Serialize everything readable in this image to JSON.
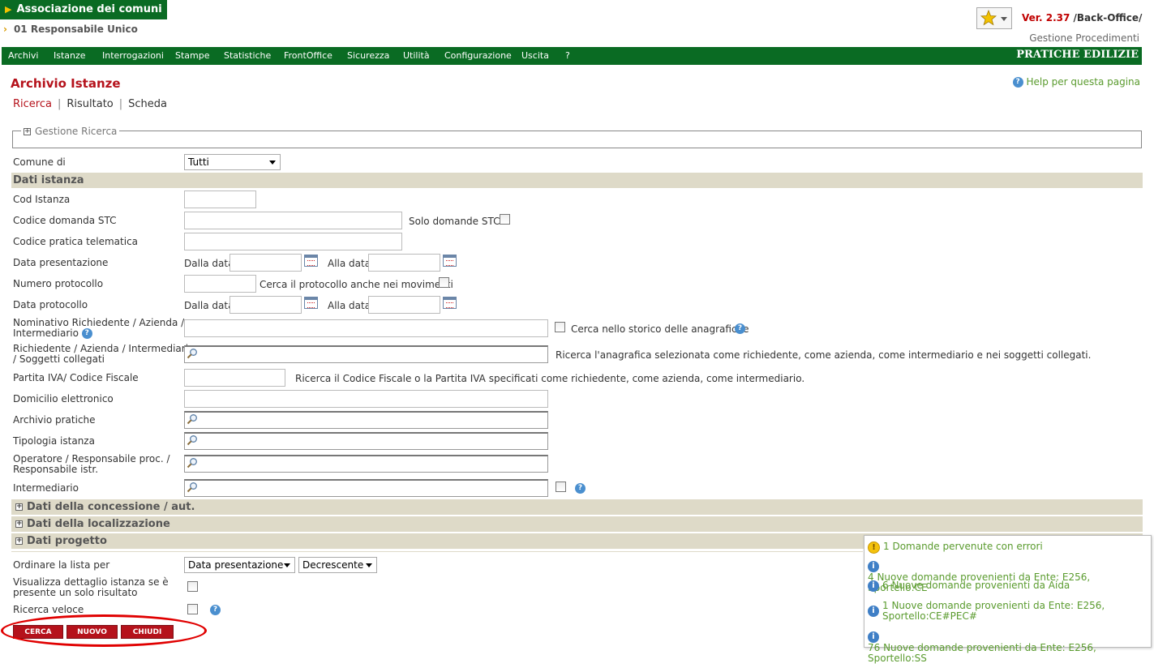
{
  "header": {
    "tree_root": "Associazione dei comuni",
    "tree_child": "01 Responsabile Unico",
    "version_label": "Ver. 2.37",
    "version_suffix": " /Back-Office/",
    "subtitle": "Gestione Procedimenti"
  },
  "menu": {
    "items": [
      "Archivi",
      "Istanze",
      "Interrogazioni",
      "Stampe",
      "Statistiche",
      "FrontOffice",
      "Sicurezza",
      "Utilità",
      "Configurazione",
      "Uscita",
      "?"
    ],
    "brand": "PRATICHE EDILIZIE"
  },
  "page": {
    "title": "Archivio Istanze",
    "help": "Help per questa pagina",
    "tabs": [
      "Ricerca",
      "Risultato",
      "Scheda"
    ],
    "active_tab": "Ricerca",
    "fieldset_legend": "Gestione Ricerca"
  },
  "form": {
    "comune_label": "Comune di",
    "comune_value": "Tutti",
    "section_dati_istanza": "Dati istanza",
    "cod_istanza": "Cod Istanza",
    "codice_domanda_stc": "Codice domanda STC",
    "solo_domande_stc": "Solo domande STC",
    "codice_pratica_telematica": "Codice pratica telematica",
    "data_presentazione": "Data presentazione",
    "dalla_data": "Dalla data",
    "alla_data": "Alla data",
    "numero_protocollo": "Numero protocollo",
    "cerca_protocollo_movimenti": "Cerca il protocollo anche nei movimenti",
    "data_protocollo": "Data protocollo",
    "nominativo_line1": "Nominativo Richiedente / Azienda /",
    "nominativo_line2": "Intermediario",
    "cerca_storico": "Cerca nello storico delle anagrafiche",
    "richiedente_line1": "Richiedente / Azienda / Intermediario",
    "richiedente_line2": "/ Soggetti collegati",
    "richiedente_hint": "Ricerca l'anagrafica selezionata come richiedente, come azienda, come intermediario e nei soggetti collegati.",
    "partita_iva": "Partita IVA/ Codice Fiscale",
    "partita_iva_hint": "Ricerca il Codice Fiscale o la Partita IVA specificati come richiedente, come azienda, come intermediario.",
    "domicilio": "Domicilio elettronico",
    "archivio_pratiche": "Archivio pratiche",
    "tipologia_istanza": "Tipologia istanza",
    "operatore_line1": "Operatore / Responsabile proc. /",
    "operatore_line2": "Responsabile istr.",
    "intermediario": "Intermediario",
    "section_concessione": "Dati della concessione / aut.",
    "section_localizzazione": "Dati della localizzazione",
    "section_progetto": "Dati progetto",
    "ordinare_label": "Ordinare la lista per",
    "ordinare_value": "Data presentazione",
    "ordine_value": "Decrescente",
    "visualizza_line1": "Visualizza dettaglio istanza se è",
    "visualizza_line2": "presente un solo risultato",
    "ricerca_veloce": "Ricerca veloce"
  },
  "buttons": {
    "cerca": "CERCA",
    "nuovo": "NUOVO",
    "chiudi": "CHIUDI"
  },
  "notifications": [
    {
      "type": "warning",
      "icon": "warning-icon",
      "text": "1 Domande pervenute con errori"
    },
    {
      "type": "info",
      "icon": "info-icon",
      "text": "4 Nuove domande provenienti da Ente: E256, Sportello:CE"
    },
    {
      "type": "info",
      "icon": "info-icon",
      "text": "6 Nuove domande provenienti da Aida"
    },
    {
      "type": "info",
      "icon": "info-icon",
      "text_line1": "1 Nuove domande provenienti da Ente: E256,",
      "text_line2": "Sportello:CE#PEC#"
    },
    {
      "type": "info",
      "icon": "info-icon",
      "text": "76 Nuove domande provenienti da Ente: E256, Sportello:SS"
    }
  ],
  "colors": {
    "brand_green": "#0a6b23",
    "title_red": "#b5121b",
    "band": "#dedac8",
    "link_green": "#5a9b2e",
    "highlight_red": "#e00000"
  }
}
